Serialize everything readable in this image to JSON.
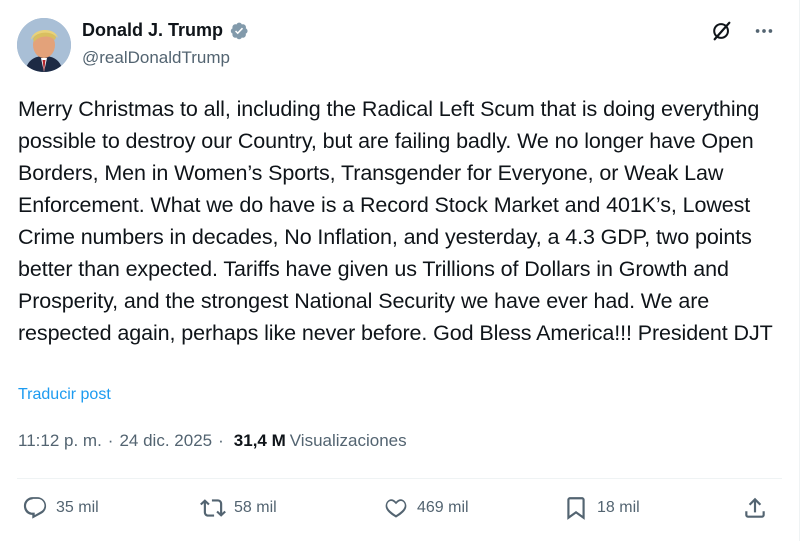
{
  "author": {
    "name": "Donald J. Trump",
    "handle": "@realDonaldTrump",
    "verified": true
  },
  "icons": {
    "avatar": "avatar-photo",
    "verified": "verified-badge-icon",
    "grok": "grok-icon",
    "more": "more-horizontal-icon"
  },
  "post": {
    "text": "Merry Christmas to all, including the Radical Left Scum that is doing everything possible to destroy our Country, but are failing badly. We no longer have Open Borders, Men in Women’s Sports, Transgender for Everyone, or Weak Law Enforcement. What we do have is a Record Stock Market and 401K’s, Lowest Crime numbers in decades, No Inflation, and yesterday, a 4.3 GDP, two points better than expected. Tariffs have given us Trillions of Dollars in Growth and Prosperity, and the strongest National Security we have ever had. We are respected again, perhaps like never before. God Bless America!!! President DJT",
    "translate_label": "Traducir post"
  },
  "meta": {
    "time": "11:12 p. m.",
    "separator": "·",
    "date": "24 dic. 2025",
    "views_count": "31,4 M",
    "views_label": "Visualizaciones"
  },
  "actions": {
    "replies": "35 mil",
    "reposts": "58 mil",
    "likes": "469 mil",
    "bookmarks": "18 mil"
  },
  "colors": {
    "text": "#0f1419",
    "secondary": "#536471",
    "link": "#1d9bf0",
    "verified": "#829aab"
  }
}
